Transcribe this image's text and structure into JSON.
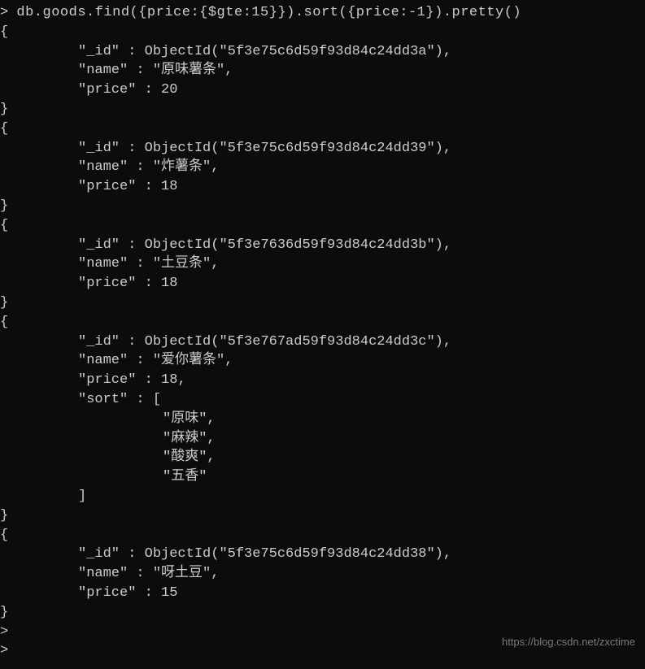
{
  "prompt": ">",
  "command": "db.goods.find({price:{$gte:15}}).sort({price:-1}).pretty()",
  "docs": [
    {
      "id_key": "\"_id\"",
      "id_val": "ObjectId(\"5f3e75c6d59f93d84c24dd3a\")",
      "name_key": "\"name\"",
      "name_val": "\"原味薯条\"",
      "price_key": "\"price\"",
      "price_val": "20",
      "has_sort": false
    },
    {
      "id_key": "\"_id\"",
      "id_val": "ObjectId(\"5f3e75c6d59f93d84c24dd39\")",
      "name_key": "\"name\"",
      "name_val": "\"炸薯条\"",
      "price_key": "\"price\"",
      "price_val": "18",
      "has_sort": false
    },
    {
      "id_key": "\"_id\"",
      "id_val": "ObjectId(\"5f3e7636d59f93d84c24dd3b\")",
      "name_key": "\"name\"",
      "name_val": "\"土豆条\"",
      "price_key": "\"price\"",
      "price_val": "18",
      "has_sort": false
    },
    {
      "id_key": "\"_id\"",
      "id_val": "ObjectId(\"5f3e767ad59f93d84c24dd3c\")",
      "name_key": "\"name\"",
      "name_val": "\"爱你薯条\"",
      "price_key": "\"price\"",
      "price_val": "18",
      "has_sort": true,
      "sort_key": "\"sort\"",
      "sort_items": [
        "\"原味\"",
        "\"麻辣\"",
        "\"酸爽\"",
        "\"五香\""
      ]
    },
    {
      "id_key": "\"_id\"",
      "id_val": "ObjectId(\"5f3e75c6d59f93d84c24dd38\")",
      "name_key": "\"name\"",
      "name_val": "\"呀土豆\"",
      "price_key": "\"price\"",
      "price_val": "15",
      "has_sort": false
    }
  ],
  "trailing_prompts": [
    ">",
    ">"
  ],
  "watermark": "https://blog.csdn.net/zxctime"
}
